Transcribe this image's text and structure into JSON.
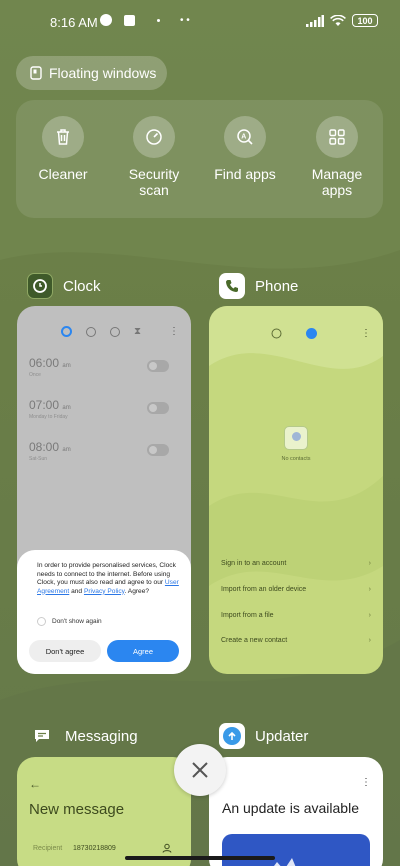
{
  "status_bar": {
    "time": "8:16 AM",
    "battery": "100"
  },
  "floating_windows": {
    "label": "Floating windows"
  },
  "quick_actions": [
    {
      "label": "Cleaner",
      "icon": "trash-icon"
    },
    {
      "label": "Security scan",
      "icon": "security-scan-icon"
    },
    {
      "label": "Find apps",
      "icon": "find-apps-icon"
    },
    {
      "label": "Manage apps",
      "icon": "grid-icon"
    }
  ],
  "clock": {
    "app_name": "Clock",
    "alarms": [
      {
        "time": "06:00",
        "ampm": "am",
        "sub": "Once"
      },
      {
        "time": "07:00",
        "ampm": "am",
        "sub": "Monday to Friday"
      },
      {
        "time": "08:00",
        "ampm": "am",
        "sub": "Sat-Sun"
      }
    ],
    "dialog": {
      "text_1": "In order to provide personalised services, Clock needs to connect to the internet. Before using Clock, you must also read and agree to our ",
      "link_1": "User Agreement",
      "text_2": " and ",
      "link_2": "Privacy Policy",
      "text_3": ". Agree?",
      "dont_show": "Don't show again",
      "dont_agree": "Don't agree",
      "agree": "Agree"
    }
  },
  "phone": {
    "app_name": "Phone",
    "no_contacts": "No contacts",
    "actions": [
      "Sign in to an account",
      "Import from an older device",
      "Import from a file",
      "Create a new contact"
    ]
  },
  "messaging": {
    "app_name": "Messaging",
    "title": "New message",
    "recipient_label": "Recipient",
    "recipient_value": "18730218809"
  },
  "updater": {
    "app_name": "Updater",
    "title": "An update is available"
  },
  "colors": {
    "accent_blue": "#2b86f0",
    "wallpaper_green": "#6e8249"
  }
}
